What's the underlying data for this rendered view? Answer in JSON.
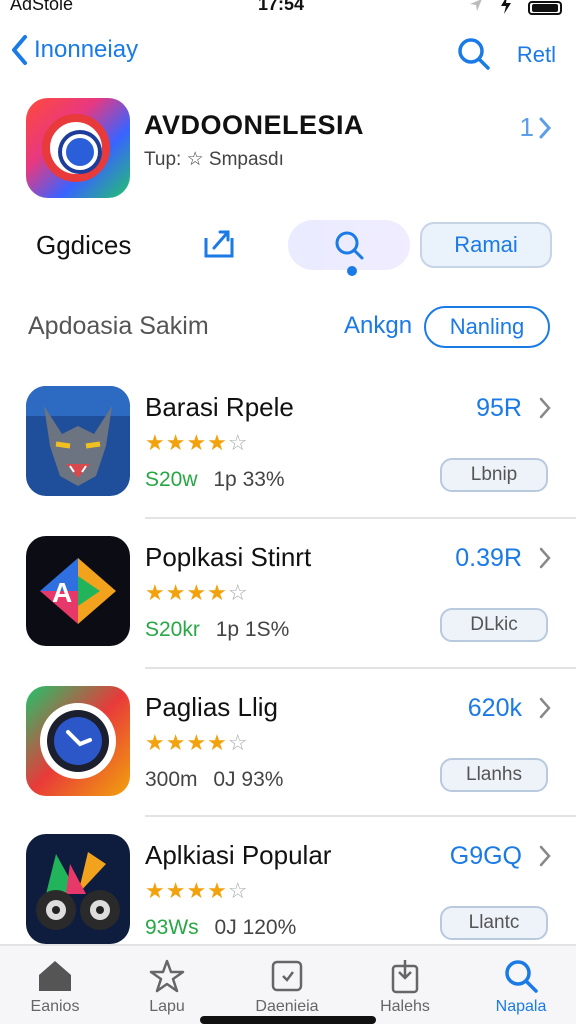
{
  "status": {
    "carrier": "AdStole",
    "time": "17:54"
  },
  "nav": {
    "back_label": "Inonneiay",
    "action_label": "Retl"
  },
  "featured": {
    "name": "AVDOONELESIA",
    "subtitle": "Tup: ☆ Smpasdı",
    "count": "1"
  },
  "actions": {
    "title": "Ggdices",
    "button_label": "Ramai"
  },
  "section": {
    "title": "Apdoasia Sakim",
    "link": "Ankgn",
    "pill": "Nanling"
  },
  "apps": [
    {
      "title": "Barasi Rpele",
      "stars": "★★★★",
      "star_off": "☆",
      "price": "S20w",
      "price_color": "#27a844",
      "rank": "1p",
      "percent": "33%",
      "count": "95R",
      "button": "Lbnip"
    },
    {
      "title": "Poplkasi Stinrt",
      "stars": "★★★★",
      "star_off": "☆",
      "price": "S20kr",
      "price_color": "#27a844",
      "rank": "1p",
      "percent": "1S%",
      "count": "0.39R",
      "button": "DLkic"
    },
    {
      "title": "Paglias Llig",
      "stars": "★★★★",
      "star_off": "☆",
      "price": "300m",
      "price_color": "#444444",
      "rank": "0J",
      "percent": "93%",
      "count": "620k",
      "button": "Llanhs"
    },
    {
      "title": "Aplkiasi Popular",
      "stars": "★★★★",
      "star_off": "☆",
      "price": "93Ws",
      "price_color": "#27a844",
      "rank": "0J",
      "percent": "120%",
      "count": "G9GQ",
      "button": "Llantc"
    }
  ],
  "tabs": [
    {
      "label": "Eanios"
    },
    {
      "label": "Lapu"
    },
    {
      "label": "Daenieia"
    },
    {
      "label": "Halehs"
    },
    {
      "label": "Napala"
    }
  ],
  "colors": {
    "accent": "#1a7ae6",
    "star": "#f2a20c",
    "price_green": "#27a844"
  }
}
